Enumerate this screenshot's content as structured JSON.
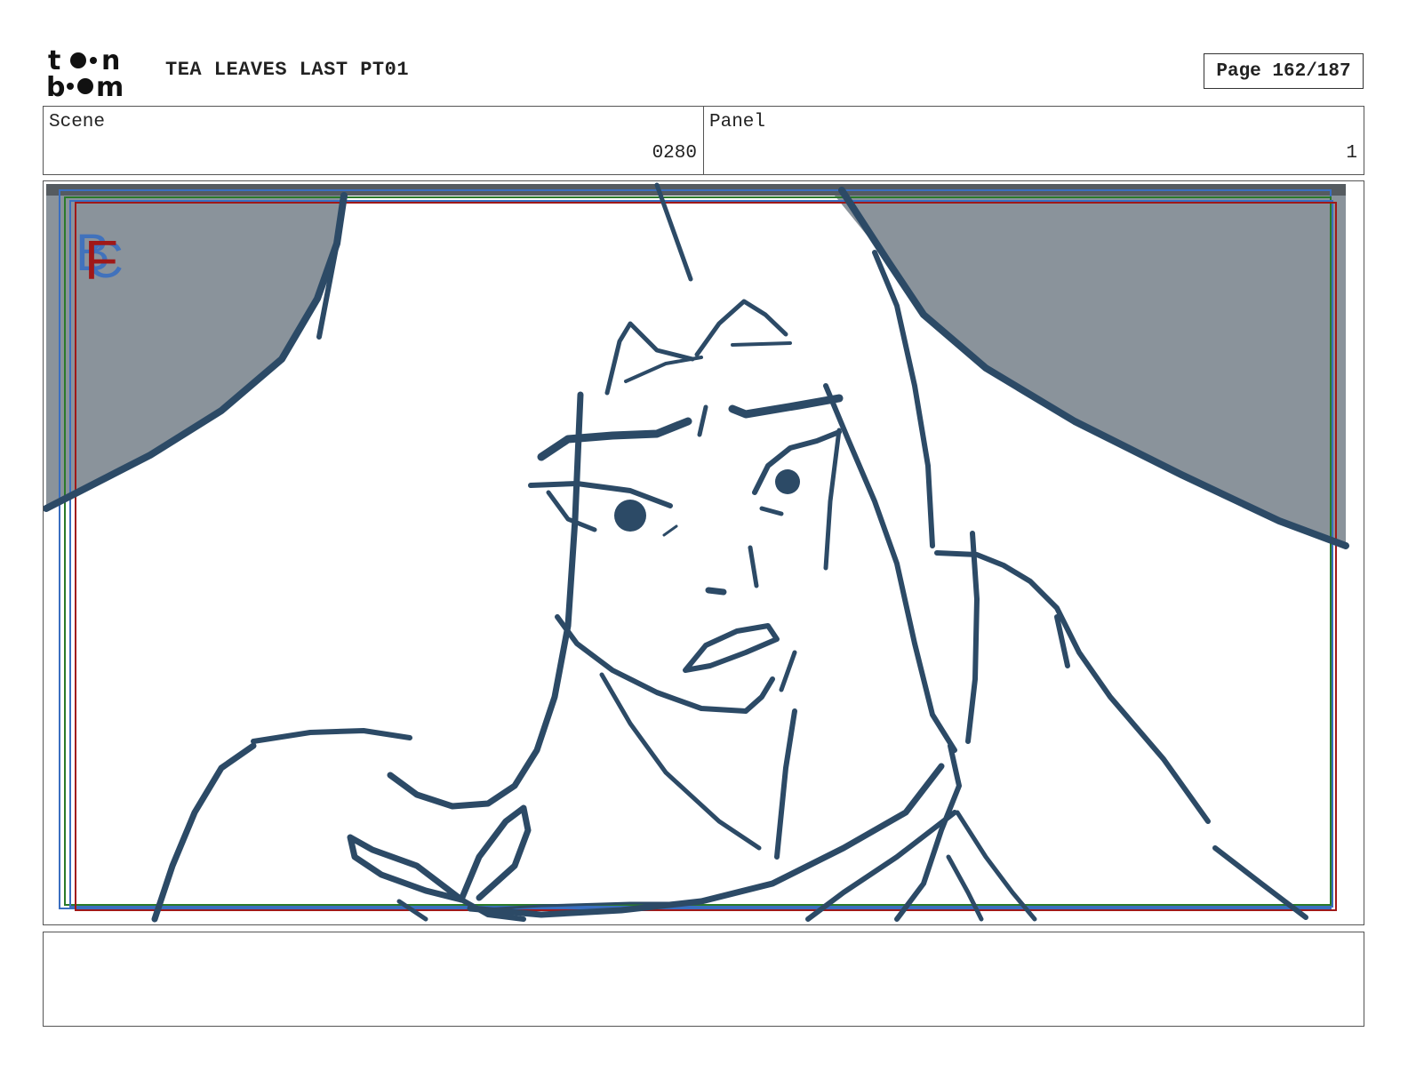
{
  "header": {
    "logo_alt": "toon boom",
    "title": "TEA LEAVES LAST PT01",
    "page_label": "Page 162/187"
  },
  "info": {
    "scene_label": "Scene",
    "scene_value": "0280",
    "panel_label": "Panel",
    "panel_value": "1"
  },
  "notes": {
    "text": ""
  },
  "colors": {
    "ink": "#2c4a66",
    "shade": "#8a939b",
    "safe_blue": "#3a6fc0",
    "safe_red": "#a01818",
    "safe_green": "#2a7a2a"
  }
}
